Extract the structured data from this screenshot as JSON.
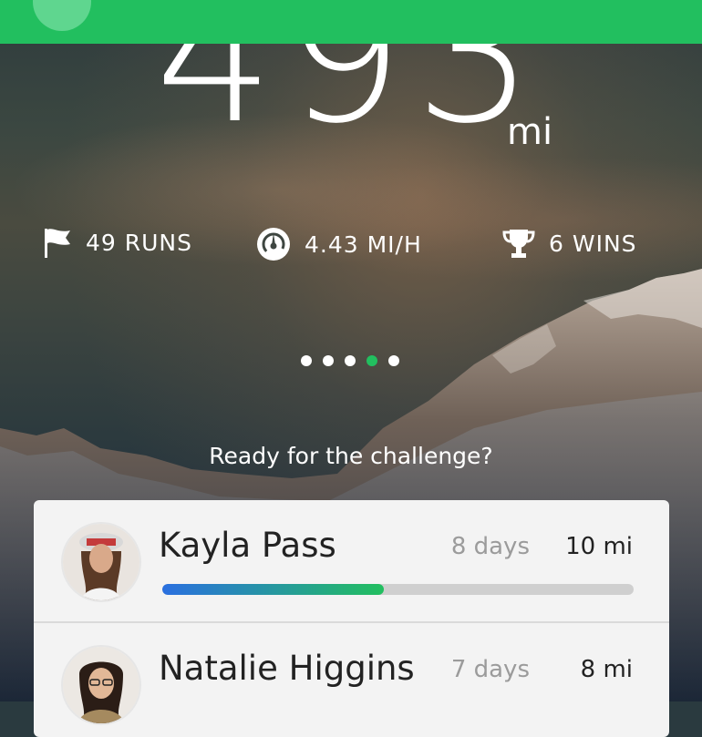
{
  "topbar": {
    "color": "#22bf5f"
  },
  "hero": {
    "distance": "493",
    "unit": "mi"
  },
  "stats": [
    {
      "icon": "flag-icon",
      "label": "49 RUNS"
    },
    {
      "icon": "speedometer-icon",
      "label": "4.43 MI/H"
    },
    {
      "icon": "trophy-icon",
      "label": "6 WINS"
    }
  ],
  "pager": {
    "count": 5,
    "active_index": 3
  },
  "prompt": "Ready for the challenge?",
  "challengers": [
    {
      "name": "Kayla Pass",
      "days": "8 days",
      "miles": "10 mi",
      "progress": 0.47
    },
    {
      "name": "Natalie Higgins",
      "days": "7 days",
      "miles": "8 mi"
    }
  ],
  "colors": {
    "accent": "#22bf5f",
    "progress_start": "#2a6fe0",
    "progress_end": "#22bf5f"
  }
}
